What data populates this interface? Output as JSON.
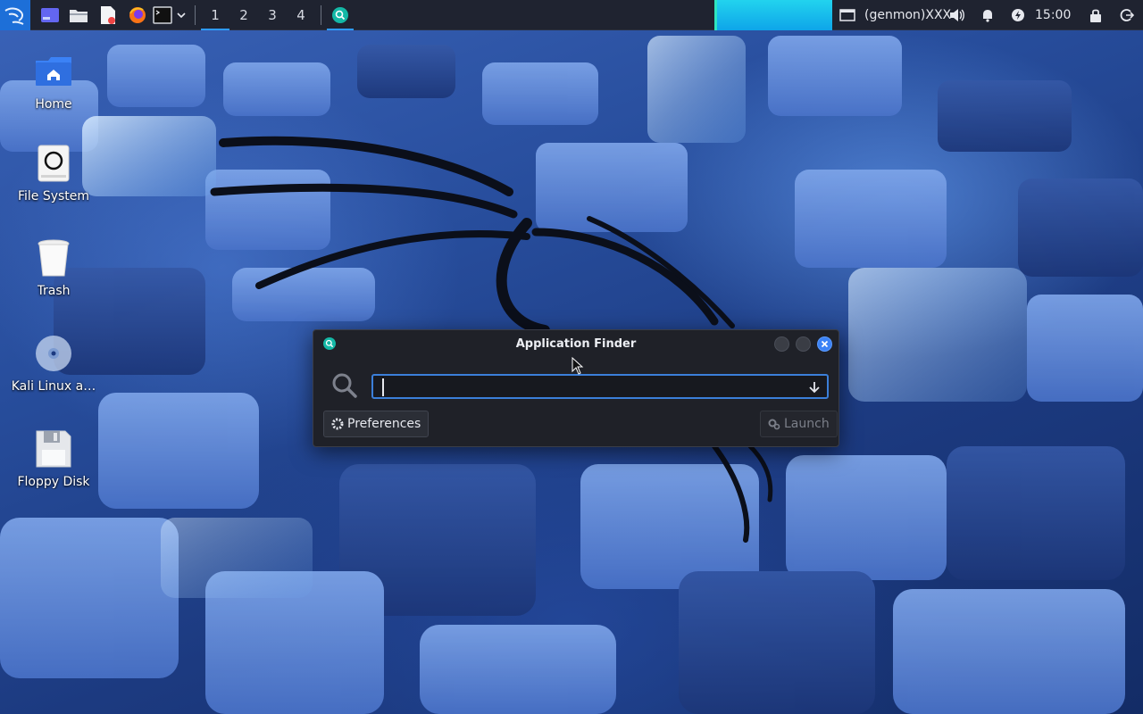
{
  "panel": {
    "workspaces": [
      "1",
      "2",
      "3",
      "4"
    ],
    "active_workspace": "1",
    "genmon": "(genmon)XXX",
    "clock": "15:00"
  },
  "desktop": {
    "icons": [
      {
        "label": "Home",
        "icon": "home-folder-icon"
      },
      {
        "label": "File System",
        "icon": "drive-icon"
      },
      {
        "label": "Trash",
        "icon": "trash-icon"
      },
      {
        "label": "Kali Linux a…",
        "icon": "optical-disc-icon"
      },
      {
        "label": "Floppy Disk",
        "icon": "floppy-disk-icon"
      }
    ]
  },
  "finder": {
    "title": "Application Finder",
    "search_value": "",
    "preferences_label": "Preferences",
    "launch_label": "Launch"
  },
  "colors": {
    "panel_bg": "#1f2330",
    "accent": "#2e9bff",
    "window_bg": "#1f2128",
    "close_button": "#3b82f6"
  }
}
